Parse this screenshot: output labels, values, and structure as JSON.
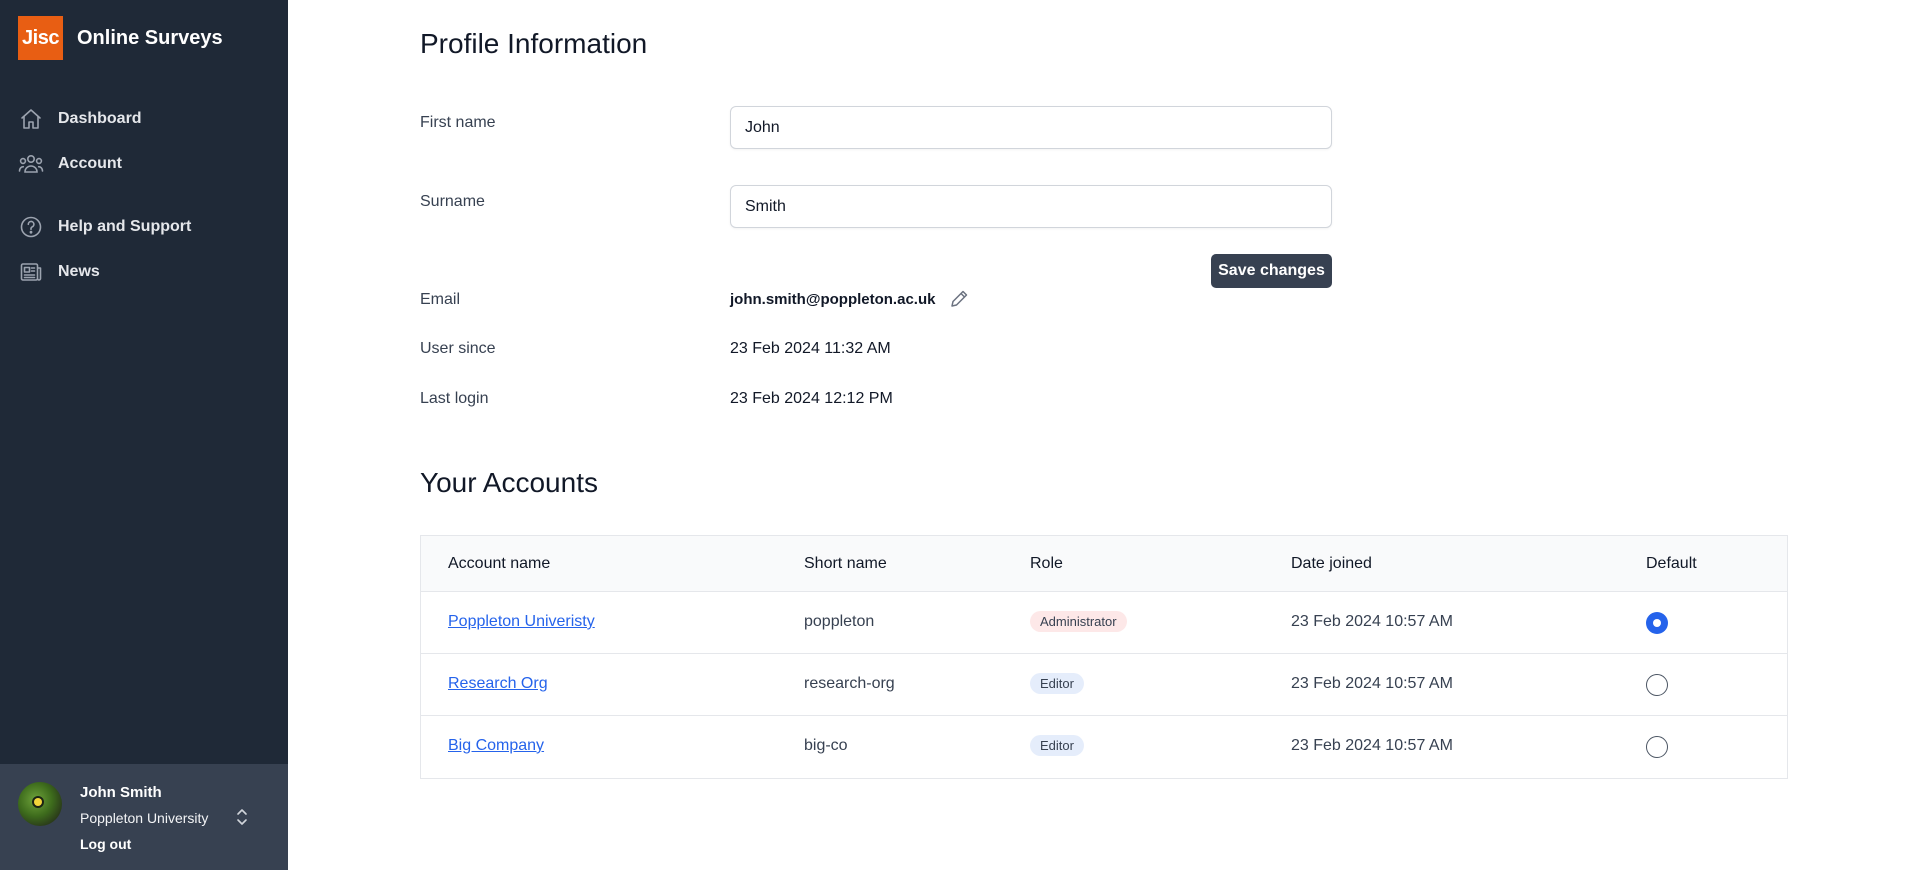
{
  "app": {
    "logo_text": "Jisc",
    "name": "Online Surveys"
  },
  "nav": {
    "dashboard": "Dashboard",
    "account": "Account",
    "help": "Help and Support",
    "news": "News"
  },
  "user": {
    "name": "John Smith",
    "org": "Poppleton University",
    "logout": "Log out"
  },
  "profile": {
    "title": "Profile Information",
    "first_name_label": "First name",
    "first_name_value": "John",
    "surname_label": "Surname",
    "surname_value": "Smith",
    "save_label": "Save changes",
    "email_label": "Email",
    "email_value": "john.smith@poppleton.ac.uk",
    "user_since_label": "User since",
    "user_since_value": "23 Feb 2024 11:32 AM",
    "last_login_label": "Last login",
    "last_login_value": "23 Feb 2024 12:12 PM"
  },
  "accounts": {
    "title": "Your Accounts",
    "headers": [
      "Account name",
      "Short name",
      "Role",
      "Date joined",
      "Default"
    ],
    "rows": [
      {
        "name": "Poppleton Univeristy",
        "short": "poppleton",
        "role": "Administrator",
        "joined": "23 Feb 2024 10:57 AM",
        "default": true
      },
      {
        "name": "Research Org",
        "short": "research-org",
        "role": "Editor",
        "joined": "23 Feb 2024 10:57 AM",
        "default": false
      },
      {
        "name": "Big Company",
        "short": "big-co",
        "role": "Editor",
        "joined": "23 Feb 2024 10:57 AM",
        "default": false
      }
    ]
  },
  "colors": {
    "sidebar": "#1f2937",
    "brand": "#e85e13",
    "accent": "#2563eb",
    "button": "#374151"
  }
}
